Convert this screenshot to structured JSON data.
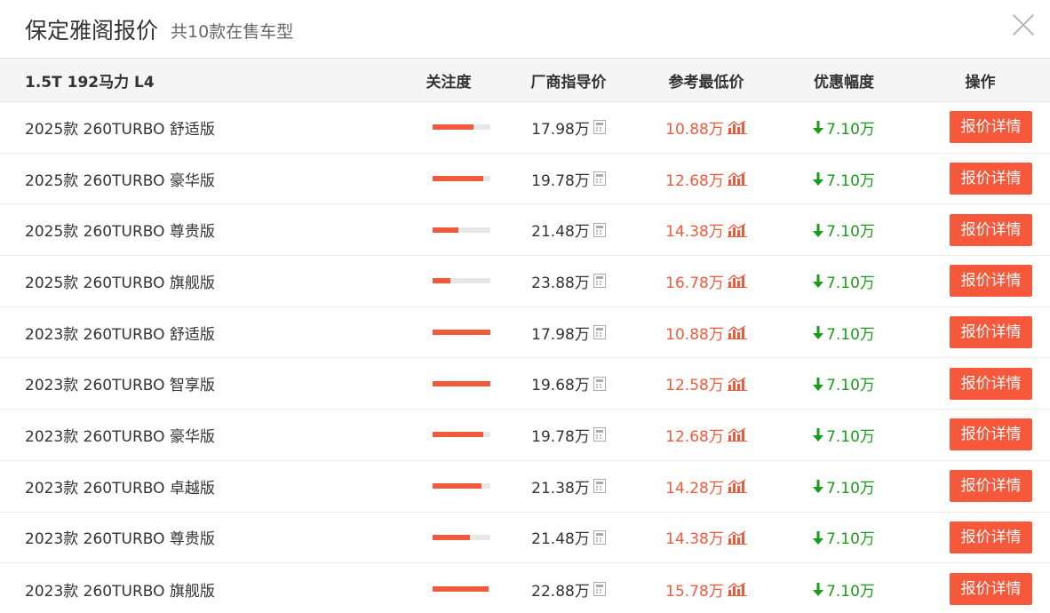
{
  "header": {
    "title": "保定雅阁报价",
    "subtitle": "共10款在售车型"
  },
  "colors": {
    "accent": "#f05a3c",
    "button": "#f5583a",
    "discount": "#1a9c1a"
  },
  "table": {
    "group_label": "1.5T 192马力 L4",
    "columns": [
      "关注度",
      "厂商指导价",
      "参考最低价",
      "优惠幅度",
      "操作"
    ],
    "rows": [
      {
        "name": "2025款 260TURBO 舒适版",
        "attention": 0.72,
        "msrp": "17.98万",
        "lowest": "10.88万",
        "discount": "7.10万",
        "action": "报价详情"
      },
      {
        "name": "2025款 260TURBO 豪华版",
        "attention": 0.88,
        "msrp": "19.78万",
        "lowest": "12.68万",
        "discount": "7.10万",
        "action": "报价详情"
      },
      {
        "name": "2025款 260TURBO 尊贵版",
        "attention": 0.45,
        "msrp": "21.48万",
        "lowest": "14.38万",
        "discount": "7.10万",
        "action": "报价详情"
      },
      {
        "name": "2025款 260TURBO 旗舰版",
        "attention": 0.32,
        "msrp": "23.88万",
        "lowest": "16.78万",
        "discount": "7.10万",
        "action": "报价详情"
      },
      {
        "name": "2023款 260TURBO 舒适版",
        "attention": 1.0,
        "msrp": "17.98万",
        "lowest": "10.88万",
        "discount": "7.10万",
        "action": "报价详情"
      },
      {
        "name": "2023款 260TURBO 智享版",
        "attention": 1.0,
        "msrp": "19.68万",
        "lowest": "12.58万",
        "discount": "7.10万",
        "action": "报价详情"
      },
      {
        "name": "2023款 260TURBO 豪华版",
        "attention": 0.88,
        "msrp": "19.78万",
        "lowest": "12.68万",
        "discount": "7.10万",
        "action": "报价详情"
      },
      {
        "name": "2023款 260TURBO 卓越版",
        "attention": 0.85,
        "msrp": "21.38万",
        "lowest": "14.28万",
        "discount": "7.10万",
        "action": "报价详情"
      },
      {
        "name": "2023款 260TURBO 尊贵版",
        "attention": 0.65,
        "msrp": "21.48万",
        "lowest": "14.38万",
        "discount": "7.10万",
        "action": "报价详情"
      },
      {
        "name": "2023款 260TURBO 旗舰版",
        "attention": 0.98,
        "msrp": "22.88万",
        "lowest": "15.78万",
        "discount": "7.10万",
        "action": "报价详情"
      }
    ]
  }
}
